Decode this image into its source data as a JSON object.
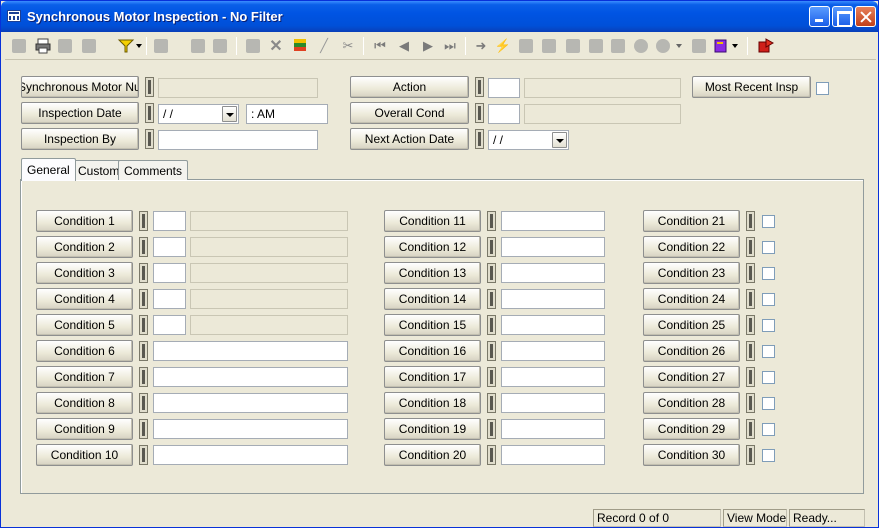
{
  "window": {
    "title": "Synchronous Motor Inspection - No Filter"
  },
  "header": {
    "asset_label": "Synchronous Motor Numb",
    "inspection_date_label": "Inspection Date",
    "inspection_date_value": " / /",
    "inspection_time_value": " :  AM",
    "inspection_by_label": "Inspection By",
    "action_label": "Action",
    "overall_cond_label": "Overall Cond",
    "next_action_date_label": "Next Action Date",
    "next_action_date_value": " / /",
    "most_recent_label": "Most Recent Insp"
  },
  "tabs": [
    {
      "label": "General"
    },
    {
      "label": "Custom"
    },
    {
      "label": "Comments"
    }
  ],
  "conditions": {
    "col1": [
      "Condition 1",
      "Condition 2",
      "Condition 3",
      "Condition 4",
      "Condition 5",
      "Condition 6",
      "Condition 7",
      "Condition 8",
      "Condition 9",
      "Condition 10"
    ],
    "col2": [
      "Condition 11",
      "Condition 12",
      "Condition 13",
      "Condition 14",
      "Condition 15",
      "Condition 16",
      "Condition 17",
      "Condition 18",
      "Condition 19",
      "Condition 20"
    ],
    "col3": [
      "Condition 21",
      "Condition 22",
      "Condition 23",
      "Condition 24",
      "Condition 25",
      "Condition 26",
      "Condition 27",
      "Condition 28",
      "Condition 29",
      "Condition 30"
    ]
  },
  "status": {
    "record": "Record 0 of 0",
    "mode": "View Mode",
    "state": "Ready..."
  },
  "toolbar_icons": [
    "form-icon",
    "print-icon",
    "preview-icon",
    "tools-icon",
    "filter-icon",
    "report-icon",
    "copy-icon",
    "paste-icon",
    "save-icon",
    "delete-icon",
    "stack-icon",
    "pencil-icon",
    "cut-icon",
    "first-record-icon",
    "prev-record-icon",
    "next-record-icon",
    "last-record-icon",
    "goto-icon",
    "lightning-icon",
    "tree-icon",
    "network-icon",
    "grid-icon",
    "calc-icon",
    "image-icon",
    "oval-icon",
    "globe-icon",
    "keyboard-icon",
    "book-icon",
    "exit-icon"
  ],
  "colors": {
    "titlebar": "#0054e3",
    "window_bg": "#ece9d8",
    "filter_yellow": "#f5d000",
    "exit_red": "#d0201a"
  }
}
